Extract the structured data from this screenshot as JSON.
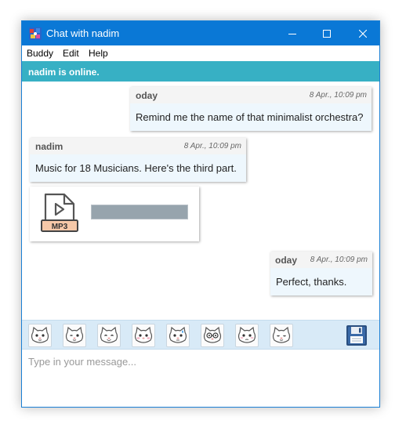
{
  "window": {
    "title": "Chat with nadim",
    "colors": {
      "titlebar": "#0a78d6",
      "status": "#37b0c4",
      "toolbar": "#d8eaf7"
    }
  },
  "menu": {
    "items": [
      {
        "label": "Buddy"
      },
      {
        "label": "Edit"
      },
      {
        "label": "Help"
      }
    ]
  },
  "status": {
    "text": "nadim is online."
  },
  "messages": [
    {
      "sender": "oday",
      "time": "8 Apr., 10:09 pm",
      "text": "Remind me the name of that minimalist orchestra?"
    },
    {
      "sender": "nadim",
      "time": "8 Apr., 10:09 pm",
      "text": "Music for 18 Musicians. Here's the third part."
    },
    {
      "type": "file",
      "file_label": "MP3",
      "icon": "mp3-file-icon"
    },
    {
      "sender": "oday",
      "time": "8 Apr., 10:09 pm",
      "text": "Perfect, thanks."
    }
  ],
  "toolbar": {
    "emoticons": [
      "smile-cat-emoticon",
      "wink-cat-emoticon",
      "grin-cat-emoticon",
      "blush-cat-emoticon",
      "sweat-cat-emoticon",
      "glasses-cat-emoticon",
      "shy-cat-emoticon",
      "calm-cat-emoticon"
    ],
    "save_icon": "floppy-disk-icon"
  },
  "input": {
    "placeholder": "Type in your message...",
    "value": ""
  }
}
